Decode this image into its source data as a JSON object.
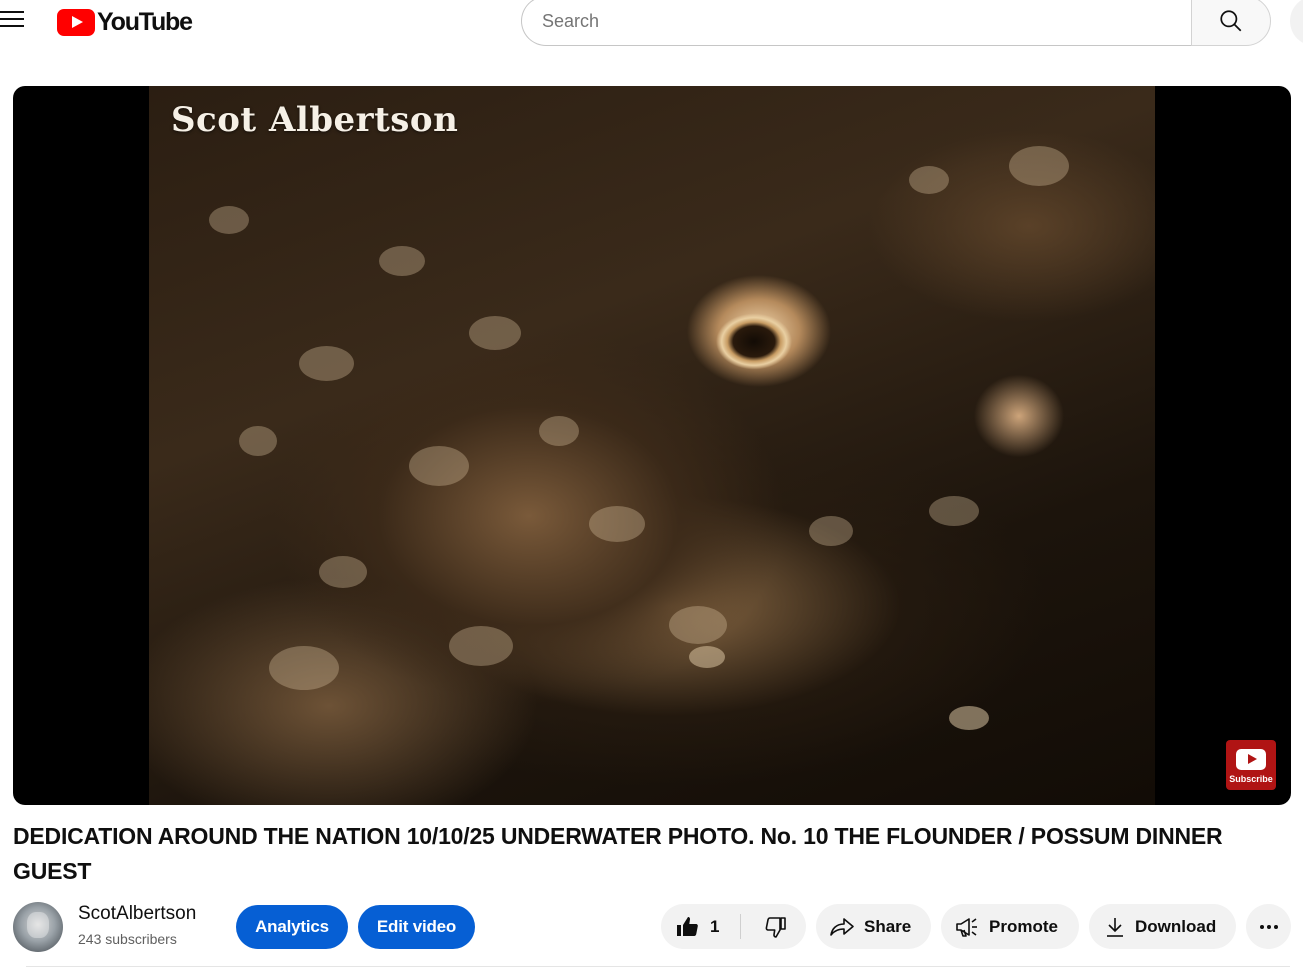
{
  "header": {
    "logo_text": "YouTube",
    "search_placeholder": "Search"
  },
  "player": {
    "watermark": "Scot Albertson",
    "subscribe_badge_label": "Subscribe"
  },
  "video": {
    "title": "DEDICATION AROUND THE NATION 10/10/25 UNDERWATER PHOTO. No. 10 THE FLOUNDER / POSSUM DINNER GUEST"
  },
  "channel": {
    "name": "ScotAlbertson",
    "subscribers": "243 subscribers"
  },
  "actions": {
    "analytics_label": "Analytics",
    "edit_video_label": "Edit video",
    "like_count": "1",
    "share_label": "Share",
    "promote_label": "Promote",
    "download_label": "Download"
  },
  "colors": {
    "brand_red": "#ff0000",
    "action_blue": "#065fd4",
    "pill_bg": "#f2f2f2"
  }
}
